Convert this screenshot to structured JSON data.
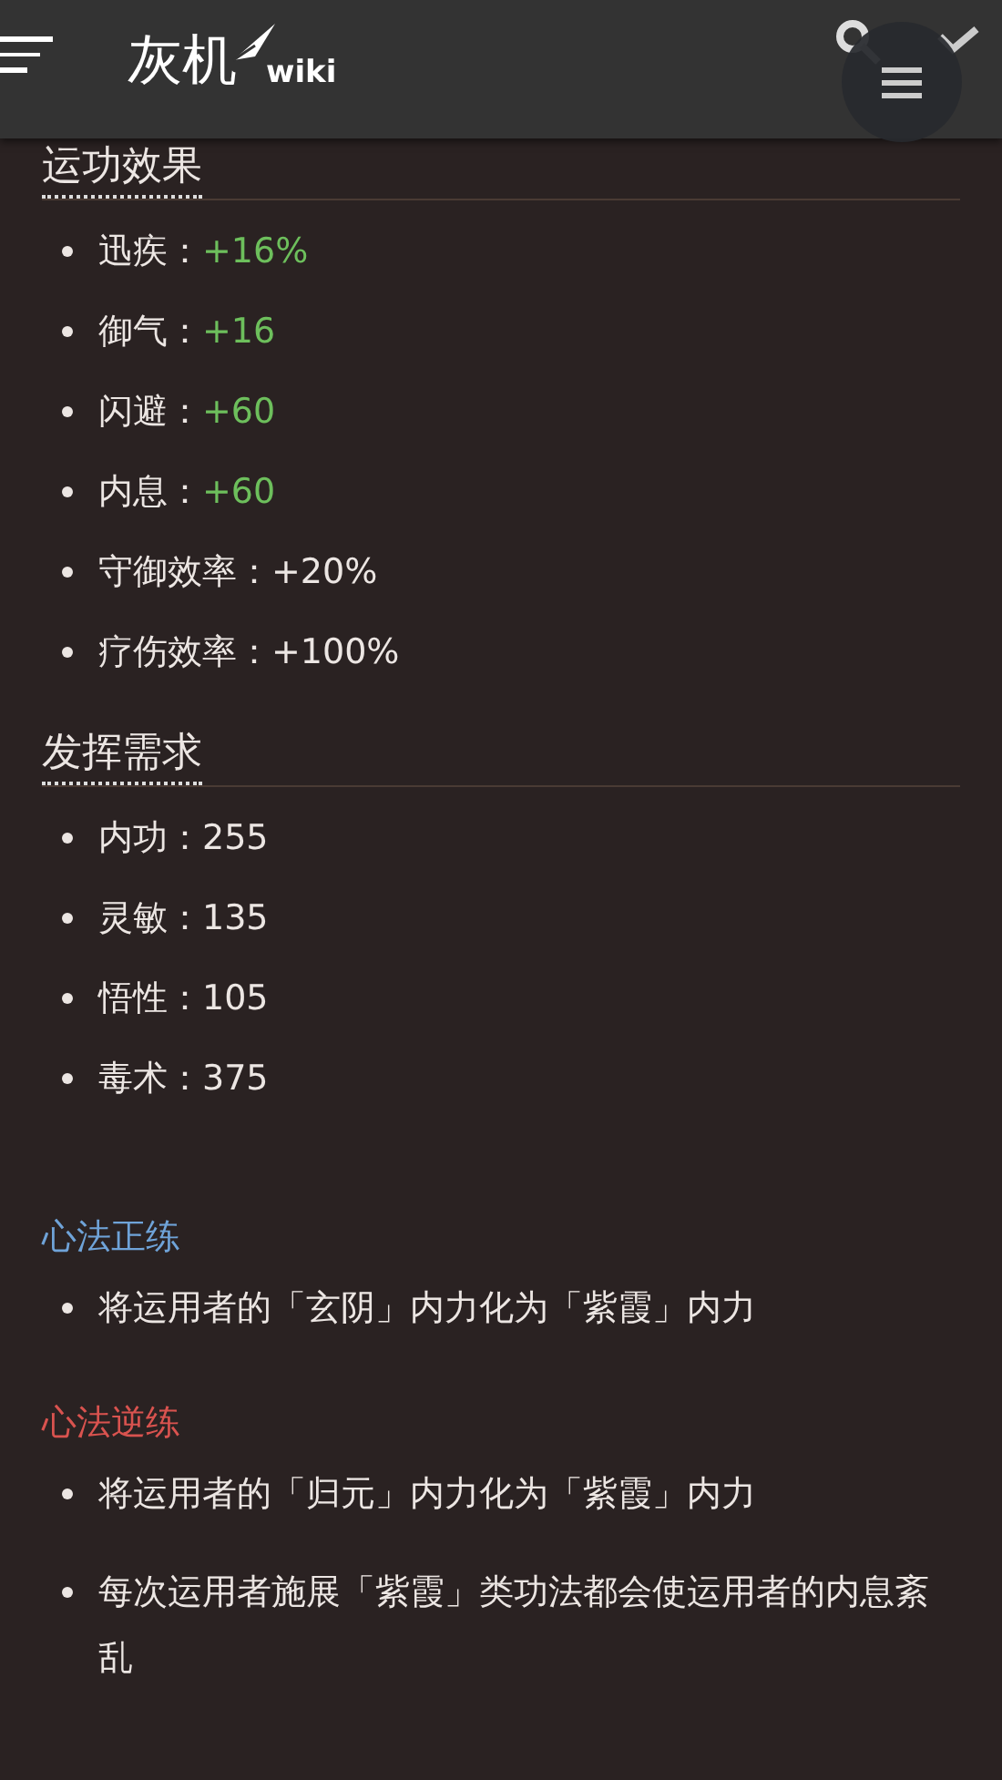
{
  "header": {
    "logo": "灰机",
    "logo_suffix": "wiki"
  },
  "sections": [
    {
      "kind": "stats",
      "title": "运功效果",
      "items": [
        {
          "label": "迅疾：",
          "value": "+16%",
          "color": "#6dbf5c"
        },
        {
          "label": "御气：",
          "value": "+16",
          "color": "#6dbf5c"
        },
        {
          "label": "闪避：",
          "value": "+60",
          "color": "#6dbf5c"
        },
        {
          "label": "内息：",
          "value": "+60",
          "color": "#6dbf5c"
        },
        {
          "label": "守御效率：",
          "value": "+20%",
          "color": "#ece6e3"
        },
        {
          "label": "疗伤效率：",
          "value": "+100%",
          "color": "#ece6e3"
        }
      ]
    },
    {
      "kind": "stats",
      "title": "发挥需求",
      "items": [
        {
          "label": "内功：",
          "value": "255",
          "color": "#ece6e3"
        },
        {
          "label": "灵敏：",
          "value": "135",
          "color": "#ece6e3"
        },
        {
          "label": "悟性：",
          "value": "105",
          "color": "#ece6e3"
        },
        {
          "label": "毒术：",
          "value": "375",
          "color": "#ece6e3"
        }
      ]
    },
    {
      "kind": "notes",
      "title": "心法正练",
      "color": "#6fa3d8",
      "items": [
        "将运用者的「玄阴」内力化为「紫霞」内力"
      ]
    },
    {
      "kind": "notes",
      "title": "心法逆练",
      "color": "#d9534f",
      "items": [
        "将运用者的「归元」内力化为「紫霞」内力",
        "每次运用者施展「紫霞」类功法都会使运用者的内息紊乱"
      ]
    }
  ]
}
